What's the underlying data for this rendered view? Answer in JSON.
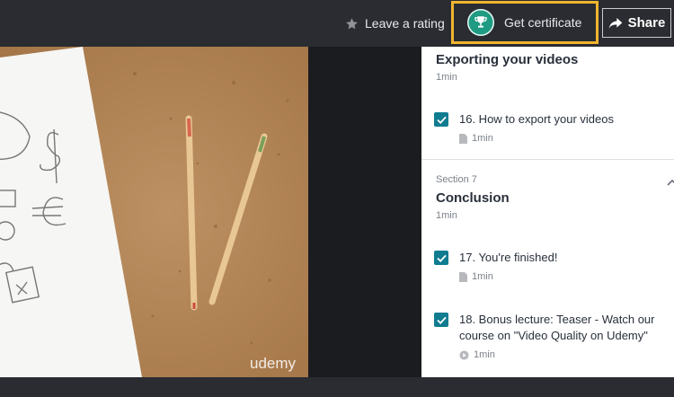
{
  "header": {
    "rating_label": "Leave a rating",
    "certificate_label": "Get certificate",
    "share_label": "Share"
  },
  "video": {
    "watermark": "udemy"
  },
  "sidebar": {
    "section6": {
      "title": "Exporting your videos",
      "duration": "1min",
      "lectures": [
        {
          "title": "16. How to export your videos",
          "duration": "1min",
          "type": "file-icon",
          "checked": true
        }
      ]
    },
    "section7": {
      "label": "Section 7",
      "title": "Conclusion",
      "duration": "1min",
      "lectures": [
        {
          "title": "17. You're finished!",
          "duration": "1min",
          "type": "file-icon",
          "checked": true
        },
        {
          "title": "18. Bonus lecture: Teaser - Watch our course on \"Video Quality on Udemy\"",
          "duration": "1min",
          "type": "play-icon",
          "checked": true
        }
      ]
    }
  },
  "colors": {
    "accent": "#f2b530",
    "certificate": "#1e9b82",
    "checkbox": "#0f7c90"
  }
}
